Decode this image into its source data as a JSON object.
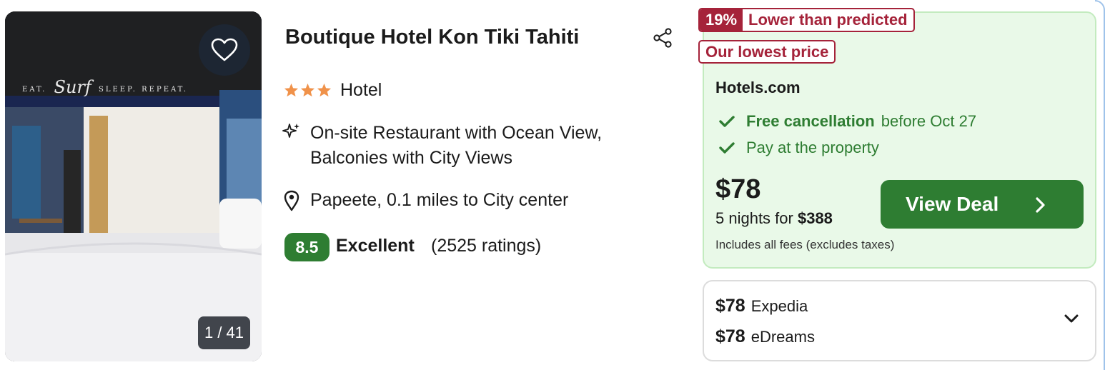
{
  "photo": {
    "sign_left": "EAT.",
    "sign_script": "Surf",
    "sign_right": "SLEEP. REPEAT.",
    "counter": "1 / 41",
    "favorite_icon": "heart-outline-icon"
  },
  "hotel": {
    "name": "Boutique Hotel Kon Tiki Tahiti",
    "star_count": 3,
    "type": "Hotel",
    "amenities": "On-site Restaurant with Ocean View, Balconies with City Views",
    "location": "Papeete, 0.1 miles to City center",
    "score": "8.5",
    "rating_label": "Excellent",
    "rating_count": "(2525 ratings)"
  },
  "deal": {
    "discount_pct": "19%",
    "discount_text": "Lower than predicted",
    "lowest_badge": "Our lowest price",
    "provider": "Hotels.com",
    "cancellation_strong": "Free cancellation",
    "cancellation_rest": "before Oct 27",
    "pay_text": "Pay at the property",
    "price": "$78",
    "nights_text": "5 nights for",
    "nights_total": "$388",
    "fees_text": "Includes all fees (excludes taxes)",
    "button_label": "View Deal"
  },
  "other_offers": [
    {
      "price": "$78",
      "provider": "Expedia"
    },
    {
      "price": "$78",
      "provider": "eDreams"
    }
  ],
  "colors": {
    "green": "#2e7d32",
    "deal_bg": "#e9f9e8",
    "badge_red": "#a5233a",
    "star": "#f0924a"
  }
}
